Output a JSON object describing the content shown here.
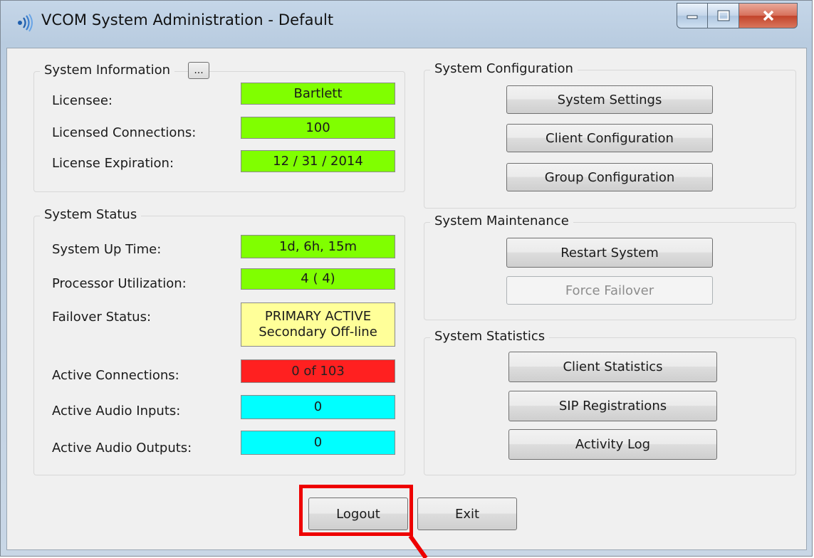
{
  "window": {
    "title": "VCOM System Administration - Default",
    "icons": {
      "app": "speaker-icon",
      "minimize": "minimize-icon",
      "maximize": "maximize-icon",
      "close": "close-icon"
    }
  },
  "system_information": {
    "title": "System Information",
    "details_button": "...",
    "rows": [
      {
        "label": "Licensee:",
        "value": "Bartlett"
      },
      {
        "label": "Licensed Connections:",
        "value": "100"
      },
      {
        "label": "License Expiration:",
        "value": "12 / 31 / 2014"
      }
    ]
  },
  "system_status": {
    "title": "System Status",
    "up_time": {
      "label": "System Up Time:",
      "value": "1d,  6h,  15m"
    },
    "processor": {
      "label": "Processor Utilization:",
      "value": "4 ( 4)"
    },
    "failover": {
      "label": "Failover Status:",
      "line1": "PRIMARY ACTIVE",
      "line2": "Secondary Off-line"
    },
    "active_connections": {
      "label": "Active Connections:",
      "value": "0 of 103"
    },
    "audio_inputs": {
      "label": "Active Audio Inputs:",
      "value": "0"
    },
    "audio_outputs": {
      "label": "Active Audio Outputs:",
      "value": "0"
    }
  },
  "system_configuration": {
    "title": "System Configuration",
    "system_settings": "System Settings",
    "client_configuration": "Client Configuration",
    "group_configuration": "Group Configuration"
  },
  "system_maintenance": {
    "title": "System Maintenance",
    "restart": "Restart System",
    "force_failover": "Force Failover"
  },
  "system_statistics": {
    "title": "System Statistics",
    "client_statistics": "Client Statistics",
    "sip_registrations": "SIP Registrations",
    "activity_log": "Activity Log"
  },
  "footer": {
    "logout": "Logout",
    "exit": "Exit"
  },
  "colors": {
    "ok": "#80ff00",
    "warning": "#ffff99",
    "alert": "#ff2020",
    "info": "#00ffff",
    "highlight": "#ee0000"
  }
}
